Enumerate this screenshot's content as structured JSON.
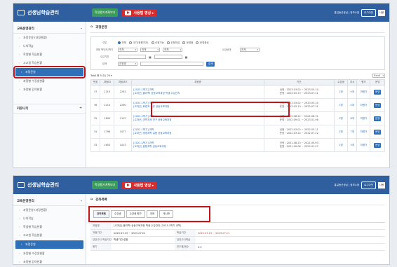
{
  "app": {
    "title": "선생님학습관리",
    "green_button": "학생평가계획보기",
    "youtube_label": "사용법 영상 ▸",
    "top_right_text": "홍길동선생님 | 정보수정",
    "logout": "로그아웃",
    "user_box": "사용"
  },
  "sidebar": {
    "section": "교육운영관리",
    "items": [
      "과정운영 (과정현황)",
      "나의학습",
      "학생별 학습현황",
      "고교생 학습현황",
      "과정운영",
      "과정별 수강생현황",
      "과정별 강의현황"
    ],
    "active_index": 4,
    "section2": "커뮤니티"
  },
  "top": {
    "breadcrumb": "과정운영",
    "filter": {
      "label_type": "구분",
      "radios": [
        "전체",
        "대기(정원초과)",
        "신청가능",
        "신청마감",
        "운영중",
        "운영종료"
      ],
      "label_sem": "과정 학년도/학기",
      "sel_year": "전체",
      "sel_sem": "전체",
      "sel_grade": "전체",
      "label_status": "수강상태",
      "sel_status": "전체",
      "label_date": "수강기간",
      "label_keyword": "검색",
      "sel_keyword": "과정명",
      "search_btn": "검색"
    },
    "table_total": "Total 총 5 건 | 20 ▾",
    "excel": "Excel",
    "headers": [
      "번호",
      "과정ID",
      "과정코드",
      "과정명",
      "기간",
      "수강생",
      "차시",
      "평가",
      "운영"
    ],
    "rows": [
      {
        "no": "37",
        "id": "2215",
        "code": "2261",
        "course1": "[2023-1학기] 과학",
        "course2": "[교과군] 물리학Ⅰ 공동교육과정 학생 수강관리",
        "period1": "신청 : 2023.03.02 ~ 2023.03.10",
        "period2": "운영 : 2023.03.13 ~ 2023.07.21",
        "students": "1명",
        "lessons": "0개",
        "eval": "미평가",
        "status": "운영"
      },
      {
        "no": "36",
        "id": "2214",
        "code": "2260",
        "course1": "[2023-1학기] 국어",
        "course2": "[교과군] 화법과 작문 공동교육과정",
        "period1": "신청 : 2023.03.02 ~ 2023.03.10",
        "period2": "운영 : 2023.03.13 ~ 2023.07.21",
        "students": "1명",
        "lessons": "0개",
        "eval": "미평가",
        "status": "운영"
      },
      {
        "no": "35",
        "id": "1899",
        "code": "1107",
        "course1": "[2022-2학기] 과학",
        "course2": "[교과군] 과학과제 연구 공동교육과정",
        "period1": "신청 : 2022.08.22 ~ 2022.08.31",
        "period2": "운영 : 2022.09.01 ~ 2023.01.06",
        "students": "3명",
        "lessons": "8개",
        "eval": "미평가",
        "status": "운영"
      },
      {
        "no": "34",
        "id": "1798",
        "code": "1077",
        "course1": "[2022-1학기] 과학",
        "course2": "[교과군] 생명과학 실험 공동교육과정",
        "period1": "신청 : 2022.03.02 ~ 2022.03.11",
        "period2": "운영 : 2022.03.14 ~ 2022.07.22",
        "students": "2명",
        "lessons": "7개",
        "eval": "미평가",
        "status": "운영"
      },
      {
        "no": "33",
        "id": "1653",
        "code": "1023",
        "course1": "[2021-2학기] 과학",
        "course2": "[교과군] 융합과학 공동교육과정",
        "period1": "신청 : 2021.08.23 ~ 2021.09.03",
        "period2": "운영 : 2021.09.06 ~ 2022.01.07",
        "students": "1명",
        "lessons": "5개",
        "eval": "미평가",
        "status": "운영"
      }
    ]
  },
  "bottom": {
    "breadcrumb": "강좌목록",
    "tabs": [
      "강의목록",
      "수강생",
      "수강생 평가",
      "과제",
      "게시판"
    ],
    "info": [
      {
        "k": "과정명",
        "v": "[교과군] 물리학Ⅰ 공동교육과정 학생 수강관리 (2023-1학기 과학)"
      },
      {
        "k": "과정기간",
        "v": "2023.03.13 ~ 2023.07.21",
        "k2": "학습기간",
        "v2": "2023.03.13 ~ 2023.07.21"
      },
      {
        "k": "담당교사 학습기간",
        "v": "학생기간 설정",
        "k2": "담당교사학습",
        "v2": ""
      },
      {
        "k": "평가",
        "v": "",
        "k2": "진도율/점수",
        "v2": "0.5"
      }
    ]
  }
}
